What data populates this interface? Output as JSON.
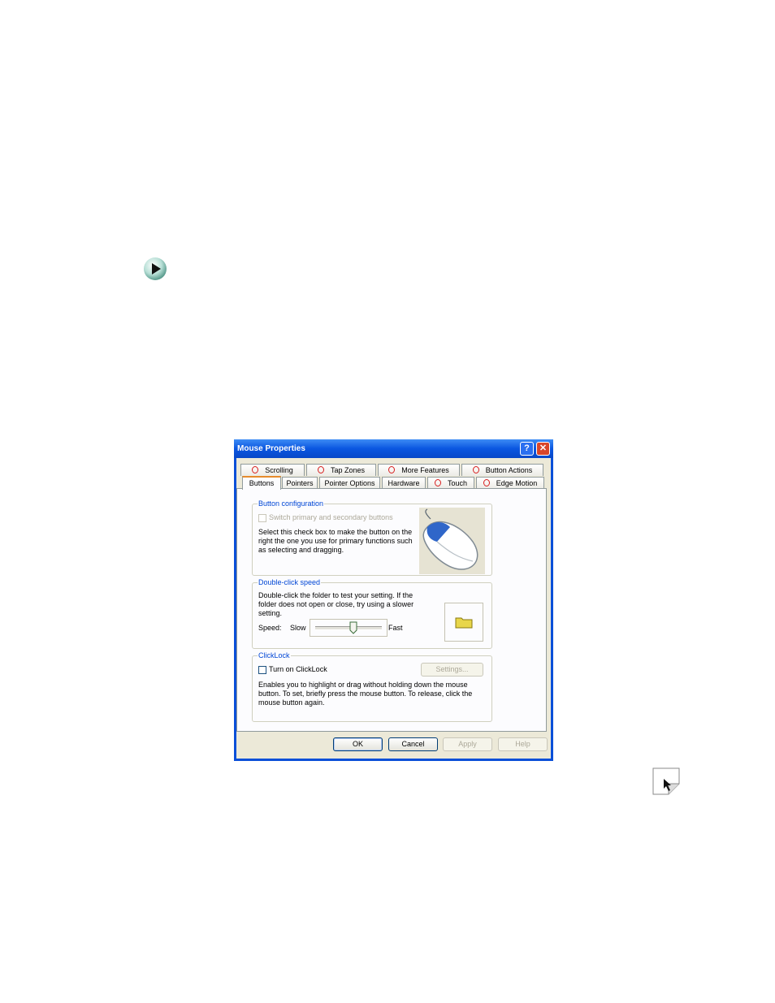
{
  "window": {
    "title": "Mouse Properties",
    "help_icon": "question-mark-icon",
    "close_icon": "close-x-icon"
  },
  "tabs": {
    "top_row": [
      "Scrolling",
      "Tap Zones",
      "More Features",
      "Button Actions"
    ],
    "bottom_row": [
      "Buttons",
      "Pointers",
      "Pointer Options",
      "Hardware",
      "Touch",
      "Edge Motion"
    ],
    "active": "Buttons"
  },
  "button_configuration": {
    "legend": "Button configuration",
    "switch_label": "Switch primary and secondary buttons",
    "description": "Select this check box to make the button on the right the one you use for primary functions such as selecting and dragging."
  },
  "double_click": {
    "legend": "Double-click speed",
    "description": "Double-click the folder to test your setting. If the folder does not open or close, try using a slower setting.",
    "speed_label": "Speed:",
    "slow_label": "Slow",
    "fast_label": "Fast",
    "speed_fraction": 0.58
  },
  "clicklock": {
    "legend": "ClickLock",
    "checkbox_label": "Turn on ClickLock",
    "settings_label": "Settings...",
    "description": "Enables you to highlight or drag without holding down the mouse button. To set, briefly press the mouse button. To release, click the mouse button again."
  },
  "footer": {
    "ok": "OK",
    "cancel": "Cancel",
    "apply": "Apply",
    "help": "Help"
  },
  "colors": {
    "title_bar": "#0a56e0",
    "legend_text": "#0046d5",
    "active_tab_accent": "#e68b2c"
  }
}
